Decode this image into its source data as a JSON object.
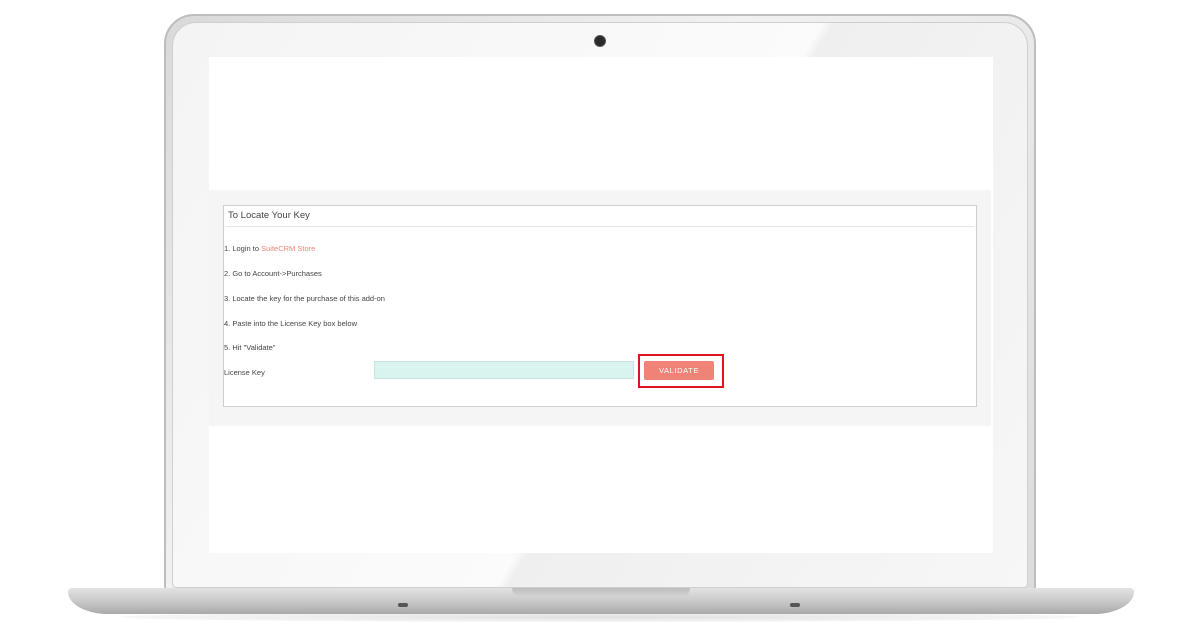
{
  "panel": {
    "title": "To Locate Your Key",
    "steps": {
      "s1_prefix": "1. Login to ",
      "s1_link": "SuiteCRM Store",
      "s2": "2. Go to Account->Purchases",
      "s3": "3. Locate the key for the purchase of this add-on",
      "s4": "4. Paste into the License Key box below",
      "s5": "5. Hit \"Validate\""
    },
    "license_label": "License Key",
    "license_value": "",
    "validate_label": "VALIDATE"
  },
  "colors": {
    "accent": "#f08377",
    "input_bg": "#d9f3ee",
    "highlight": "#e0141e"
  },
  "icons": {
    "camera": "webcam-dot"
  }
}
